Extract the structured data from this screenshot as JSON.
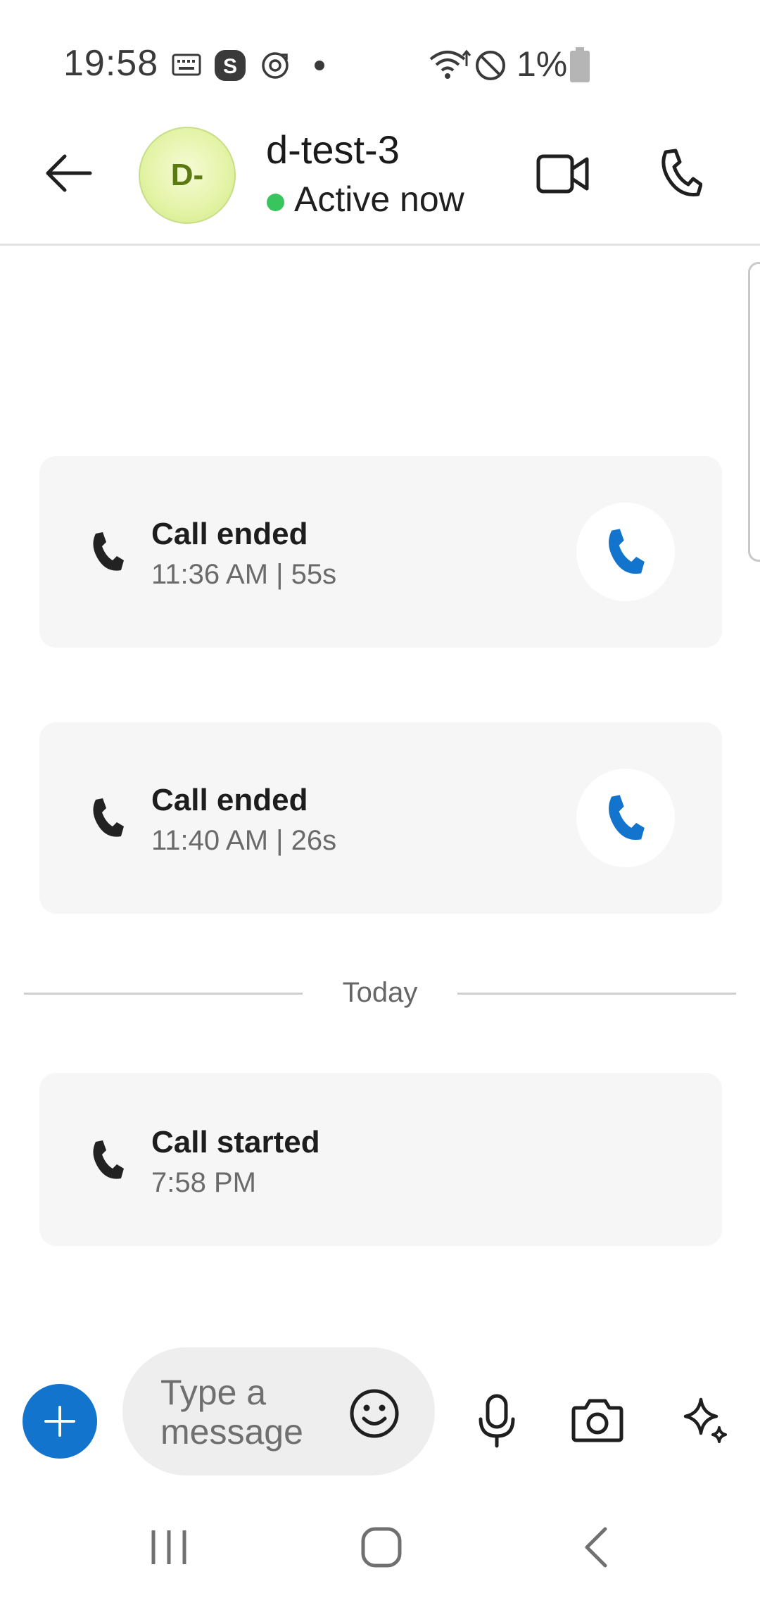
{
  "status_bar": {
    "time": "19:58",
    "battery_percent": "1%",
    "icons": [
      "keyboard-icon",
      "skype-icon",
      "sync-icon",
      "dot-icon",
      "wifi-icon",
      "do-not-disturb-icon",
      "battery-icon"
    ]
  },
  "header": {
    "avatar_initials": "D-",
    "contact_name": "d-test-3",
    "presence": "Active now",
    "presence_color": "#38c55d"
  },
  "messages": [
    {
      "title": "Call ended",
      "subtitle": "11:36 AM | 55s",
      "callback": true
    },
    {
      "title": "Call ended",
      "subtitle": "11:40 AM | 26s",
      "callback": true
    },
    {
      "title": "Call started",
      "subtitle": "7:58 PM",
      "callback": false
    }
  ],
  "date_divider": "Today",
  "composer": {
    "placeholder": "Type a message"
  },
  "colors": {
    "accent": "#1274cc",
    "card_bg": "#f6f6f6"
  }
}
